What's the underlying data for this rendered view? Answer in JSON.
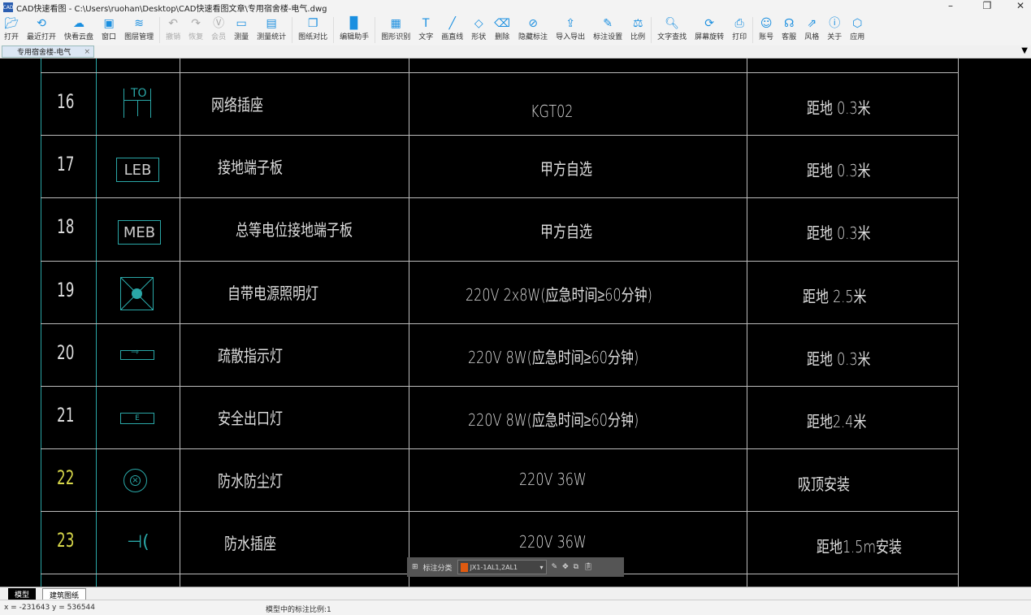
{
  "window": {
    "title": "CAD快速看图 - C:\\Users\\ruohan\\Desktop\\CAD快速看图文章\\专用宿舍楼-电气.dwg",
    "logo": "CAD"
  },
  "toolbar": [
    {
      "label": "打开",
      "icon": "folder-icon"
    },
    {
      "label": "最近打开",
      "icon": "history-icon"
    },
    {
      "label": "快看云盘",
      "icon": "cloud-icon"
    },
    {
      "label": "窗口",
      "icon": "window-icon"
    },
    {
      "label": "图层管理",
      "icon": "layers-icon"
    },
    {
      "sep": true
    },
    {
      "label": "撤销",
      "icon": "undo-icon",
      "disabled": true
    },
    {
      "label": "恢复",
      "icon": "redo-icon",
      "disabled": true
    },
    {
      "label": "会员",
      "icon": "vip-icon",
      "disabled": true
    },
    {
      "label": "测量",
      "icon": "ruler-icon"
    },
    {
      "label": "测量统计",
      "icon": "measure-stats-icon"
    },
    {
      "sep": true
    },
    {
      "label": "图纸对比",
      "icon": "compare-icon"
    },
    {
      "sep": true
    },
    {
      "label": "编辑助手",
      "icon": "edit-assistant-icon"
    },
    {
      "sep": true
    },
    {
      "label": "图形识别",
      "icon": "shape-recognize-icon"
    },
    {
      "label": "文字",
      "icon": "text-icon"
    },
    {
      "label": "画直线",
      "icon": "line-icon"
    },
    {
      "label": "形状",
      "icon": "shape-icon"
    },
    {
      "label": "删除",
      "icon": "eraser-icon"
    },
    {
      "label": "隐藏标注",
      "icon": "hide-icon"
    },
    {
      "label": "导入导出",
      "icon": "import-export-icon"
    },
    {
      "label": "标注设置",
      "icon": "annotation-settings-icon"
    },
    {
      "label": "比例",
      "icon": "scale-icon"
    },
    {
      "sep": true
    },
    {
      "label": "文字查找",
      "icon": "text-search-icon"
    },
    {
      "label": "屏幕旋转",
      "icon": "rotate-icon"
    },
    {
      "label": "打印",
      "icon": "print-icon"
    },
    {
      "sep": true
    },
    {
      "label": "账号",
      "icon": "user-icon"
    },
    {
      "label": "客服",
      "icon": "headset-icon"
    },
    {
      "label": "风格",
      "icon": "style-icon"
    },
    {
      "label": "关于",
      "icon": "info-icon"
    },
    {
      "label": "应用",
      "icon": "app-icon"
    }
  ],
  "tab": {
    "label": "专用宿舍楼-电气"
  },
  "rows": [
    {
      "no": "16",
      "symbol": "TO",
      "name": "网络插座",
      "spec": "KGT02",
      "install": "距地 0.3米",
      "yellow": false
    },
    {
      "no": "17",
      "symbol": "LEB",
      "name": "接地端子板",
      "spec": "甲方自选",
      "install": "距地 0.3米",
      "yellow": false
    },
    {
      "no": "18",
      "symbol": "MEB",
      "name": "总等电位接地端子板",
      "spec": "甲方自选",
      "install": "距地 0.3米",
      "yellow": false
    },
    {
      "no": "19",
      "symbol": "",
      "name": "自带电源照明灯",
      "spec": "220V 2x8W(应急时间≥60分钟)",
      "install": "距地 2.5米",
      "yellow": false
    },
    {
      "no": "20",
      "symbol": "",
      "name": "疏散指示灯",
      "spec": "220V 8W(应急时间≥60分钟)",
      "install": "距地 0.3米",
      "yellow": false
    },
    {
      "no": "21",
      "symbol": "E",
      "name": "安全出口灯",
      "spec": "220V 8W(应急时间≥60分钟)",
      "install": "距地2.4米",
      "yellow": false
    },
    {
      "no": "22",
      "symbol": "",
      "name": "防水防尘灯",
      "spec": "220V 36W",
      "install": "吸顶安装",
      "yellow": true
    },
    {
      "no": "23",
      "symbol": "",
      "name": "防水插座",
      "spec": "220V 36W",
      "install": "距地1.5m安装",
      "yellow": true
    }
  ],
  "annobar": {
    "label": "标注分类",
    "selected": "JX1-1AL1,2AL1",
    "color": "#e05a10"
  },
  "sheets": [
    "模型",
    "建筑图纸"
  ],
  "status": {
    "coords": "x = -231643  y = 536544",
    "scale": "模型中的标注比例:1"
  }
}
